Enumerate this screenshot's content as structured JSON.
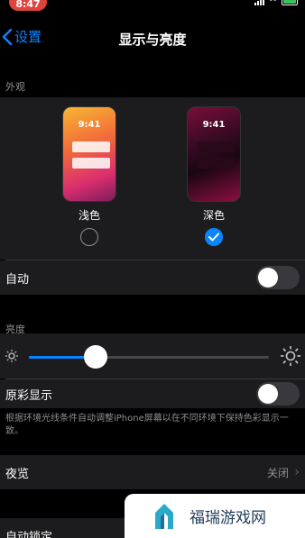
{
  "status_bar": {
    "time": "8:47"
  },
  "nav": {
    "back_label": "设置",
    "title": "显示与亮度"
  },
  "appearance": {
    "section_title": "外观",
    "light": {
      "label": "浅色",
      "clock": "9:41",
      "selected": false
    },
    "dark": {
      "label": "深色",
      "clock": "9:41",
      "selected": true
    },
    "auto_label": "自动",
    "auto_enabled": false
  },
  "brightness": {
    "section_title": "亮度",
    "level": 0.28,
    "true_tone_label": "原彩显示",
    "true_tone_enabled": false,
    "true_tone_footnote": "根据环境光线条件自动调整iPhone屏幕以在不同环境下保持色彩显示一致。"
  },
  "night_shift": {
    "label": "夜览",
    "value": "关闭"
  },
  "auto_lock": {
    "label": "自动锁定"
  },
  "watermark": {
    "text": "福瑞游戏网"
  },
  "colors": {
    "accent": "#0a84ff",
    "background": "#000000",
    "cell": "#1c1c1e"
  }
}
